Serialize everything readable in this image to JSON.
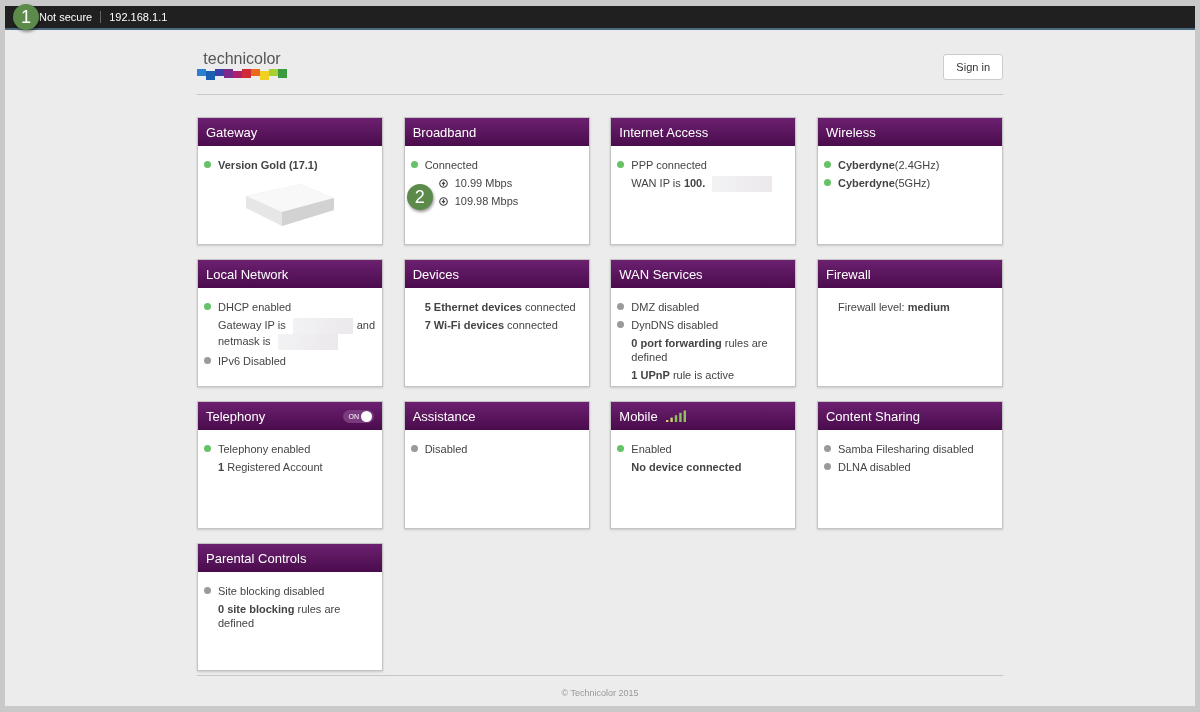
{
  "browser_bar": {
    "annotation": "1",
    "security": "Not secure",
    "address": "192.168.1.1"
  },
  "header": {
    "logo_text": "technicolor",
    "sign_in": "Sign in"
  },
  "cards": [
    {
      "title": "Gateway",
      "router": true,
      "lines": [
        {
          "kind": "status",
          "color": "#66c266",
          "text": "**Version Gold (17.1)**"
        }
      ]
    },
    {
      "title": "Broadband",
      "annotation": "2",
      "lines": [
        {
          "kind": "status",
          "color": "#66c266",
          "text": "Connected"
        },
        {
          "kind": "upload",
          "text": "10.99 Mbps"
        },
        {
          "kind": "download",
          "text": "109.98 Mbps"
        }
      ]
    },
    {
      "title": "Internet Access",
      "lines": [
        {
          "kind": "status",
          "color": "#66c266",
          "parts": [
            {
              "text": "PPP connected"
            }
          ]
        },
        {
          "kind": "text",
          "parts": [
            {
              "text": "WAN IP is **100.**"
            },
            {
              "redacted": true
            }
          ]
        }
      ]
    },
    {
      "title": "Wireless",
      "lines": [
        {
          "kind": "status",
          "color": "#66c266",
          "text": "**Cyberdyne**(2.4GHz)"
        },
        {
          "kind": "status",
          "color": "#66c266",
          "text": "**Cyberdyne**(5GHz)"
        }
      ]
    },
    {
      "title": "Local Network",
      "lines": [
        {
          "kind": "status",
          "color": "#66c266",
          "text": "DHCP enabled"
        },
        {
          "kind": "text",
          "parts": [
            {
              "text": "Gateway IP is"
            },
            {
              "redacted": true
            },
            {
              "text": "and netmask is"
            },
            {
              "redacted": true
            }
          ]
        },
        {
          "kind": "status",
          "color": "#9a9a9a",
          "text": "IPv6 Disabled"
        }
      ]
    },
    {
      "title": "Devices",
      "lines": [
        {
          "kind": "text",
          "text": "**5 Ethernet devices** connected"
        },
        {
          "kind": "text",
          "text": "**7 Wi-Fi devices** connected"
        }
      ]
    },
    {
      "title": "WAN Services",
      "lines": [
        {
          "kind": "status",
          "color": "#9a9a9a",
          "text": "DMZ disabled"
        },
        {
          "kind": "status",
          "color": "#9a9a9a",
          "text": "DynDNS disabled"
        },
        {
          "kind": "text",
          "text": "**0 port forwarding** rules are defined"
        },
        {
          "kind": "text",
          "text": "**1 UPnP** rule is active"
        }
      ]
    },
    {
      "title": "Firewall",
      "lines": [
        {
          "kind": "text",
          "text": "Firewall level: **medium**"
        }
      ]
    },
    {
      "title": "Telephony",
      "toggle": {
        "label": "ON",
        "on": true
      },
      "lines": [
        {
          "kind": "status",
          "color": "#66c266",
          "text": "Telephony enabled"
        },
        {
          "kind": "text",
          "text": "**1** Registered Account"
        }
      ]
    },
    {
      "title": "Assistance",
      "lines": [
        {
          "kind": "status",
          "color": "#9a9a9a",
          "text": "Disabled"
        }
      ]
    },
    {
      "title": "Mobile",
      "signal": true,
      "lines": [
        {
          "kind": "status",
          "color": "#66c266",
          "text": "Enabled"
        },
        {
          "kind": "text",
          "text": "**No device connected**"
        }
      ]
    },
    {
      "title": "Content Sharing",
      "lines": [
        {
          "kind": "status",
          "color": "#9a9a9a",
          "text": "Samba Filesharing disabled"
        },
        {
          "kind": "status",
          "color": "#9a9a9a",
          "text": "DLNA disabled"
        }
      ]
    },
    {
      "title": "Parental Controls",
      "lines": [
        {
          "kind": "status",
          "color": "#9a9a9a",
          "text": "Site blocking disabled"
        },
        {
          "kind": "text",
          "text": "**0 site blocking** rules are defined"
        }
      ]
    }
  ],
  "footer": "© Technicolor 2015"
}
